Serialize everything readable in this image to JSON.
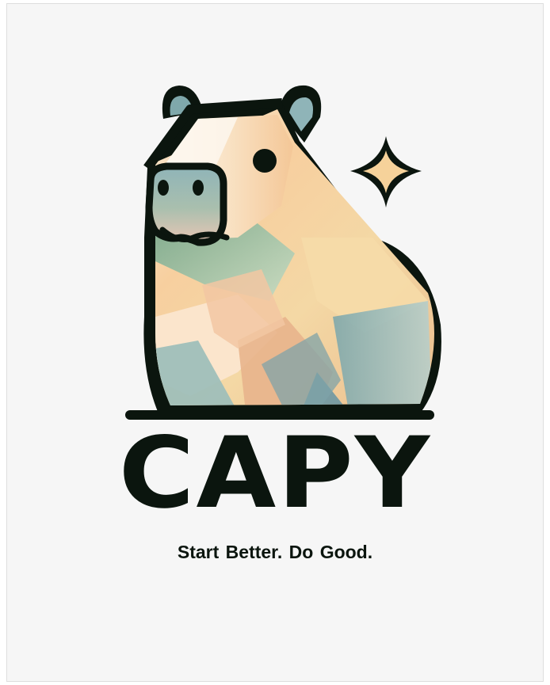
{
  "brand": {
    "name": "CAPY",
    "tagline": "Start Better.  Do Good."
  },
  "colors": {
    "background": "#f6f6f6",
    "outline": "#0b150e",
    "peach": "#f6c898",
    "cream": "#fbf0df",
    "sage": "#7fae94",
    "teal": "#8fb4b8",
    "star_fill": "#f6d29a"
  },
  "icons": [
    "capybara-mascot-icon",
    "sparkle-star-icon"
  ]
}
